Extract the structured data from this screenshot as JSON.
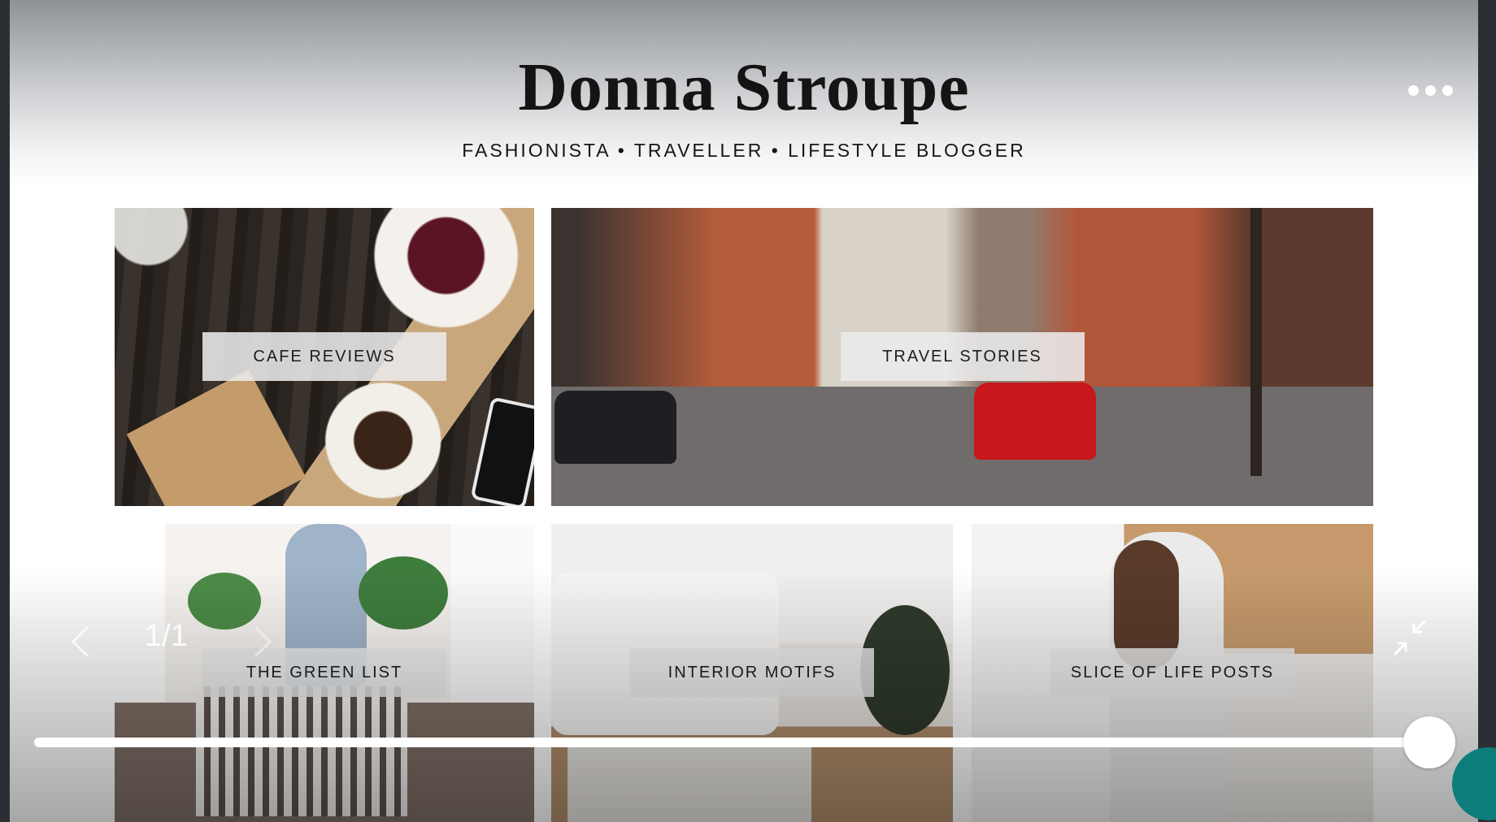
{
  "site": {
    "title": "Donna Stroupe",
    "tagline": "FASHIONISTA • TRAVELLER • LIFESTYLE BLOGGER"
  },
  "menu": {
    "icon": "more-dots-icon"
  },
  "tiles": [
    {
      "label": "CAFE REVIEWS"
    },
    {
      "label": "TRAVEL STORIES"
    },
    {
      "label": "THE GREEN LIST"
    },
    {
      "label": "INTERIOR MOTIFS"
    },
    {
      "label": "SLICE OF LIFE POSTS"
    }
  ],
  "viewer": {
    "counter": "1/1",
    "prev_icon": "chevron-left-icon",
    "next_icon": "chevron-right-icon",
    "collapse_icon": "collapse-arrows-icon",
    "progress_fraction": 1.0
  },
  "colors": {
    "accent": "#0c7d7a",
    "label_bg": "#ebebeb",
    "title": "#141414"
  }
}
